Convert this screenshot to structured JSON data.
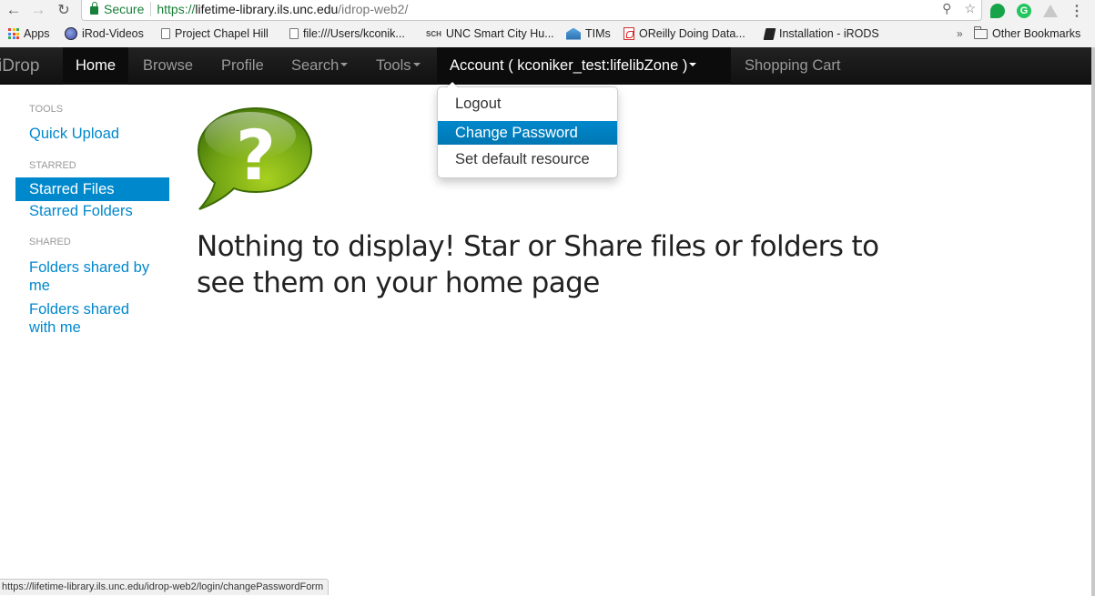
{
  "browser": {
    "secure_label": "Secure",
    "url_scheme": "https://",
    "url_host": "lifetime-library.ils.unc.edu",
    "url_path": "/idrop-web2/",
    "icons": [
      "back-arrow-icon",
      "forward-arrow-icon",
      "reload-icon",
      "lock-icon",
      "key-icon",
      "star-icon",
      "extension-icon",
      "grammarly-icon",
      "drive-icon",
      "menu-dots-icon"
    ],
    "bookmarks": [
      {
        "label": "Apps",
        "icon": "apps-grid-icon"
      },
      {
        "label": "iRod-Videos",
        "icon": "irod-icon"
      },
      {
        "label": "Project Chapel Hill",
        "icon": "page-icon"
      },
      {
        "label": "file:///Users/kconik...",
        "icon": "page-icon"
      },
      {
        "label": "UNC Smart City Hu...",
        "icon": "sch-icon"
      },
      {
        "label": "TIMs",
        "icon": "tims-icon"
      },
      {
        "label": "OReilly Doing Data...",
        "icon": "pdf-icon"
      },
      {
        "label": "Installation - iRODS",
        "icon": "book-icon"
      }
    ],
    "overflow_label": "»",
    "other_bookmarks_label": "Other Bookmarks",
    "status_url": "https://lifetime-library.ils.unc.edu/idrop-web2/login/changePasswordForm"
  },
  "navbar": {
    "brand": "iDrop",
    "items": [
      {
        "label": "Home",
        "active": true
      },
      {
        "label": "Browse"
      },
      {
        "label": "Profile"
      },
      {
        "label": "Search",
        "dropdown": true
      },
      {
        "label": "Tools",
        "dropdown": true
      },
      {
        "label": "Account ( kconiker_test:lifelibZone )",
        "dropdown": true,
        "open": true
      },
      {
        "label": "Shopping Cart"
      }
    ]
  },
  "account_menu": {
    "items": [
      {
        "label": "Logout"
      },
      {
        "label": "Change Password",
        "highlighted": true
      },
      {
        "label": "Set default resource"
      }
    ]
  },
  "sidebar": {
    "sections": [
      {
        "header": "TOOLS",
        "links": [
          {
            "label": "Quick Upload"
          }
        ]
      },
      {
        "header": "STARRED",
        "links": [
          {
            "label": "Starred Files",
            "active": true
          },
          {
            "label": "Starred Folders"
          }
        ]
      },
      {
        "header": "SHARED",
        "links": [
          {
            "label": "Folders shared by me"
          },
          {
            "label": "Folders shared with me"
          }
        ]
      }
    ]
  },
  "main": {
    "icon": "question-speech-bubble-icon",
    "message": "Nothing to display! Star or Share files or folders to see them on your home page"
  },
  "colors": {
    "link": "#0088cc",
    "navbar_bg": "#1b1b1b",
    "highlight": "#0088cc",
    "secure_green": "#188038",
    "question_green": "#7cb518"
  }
}
